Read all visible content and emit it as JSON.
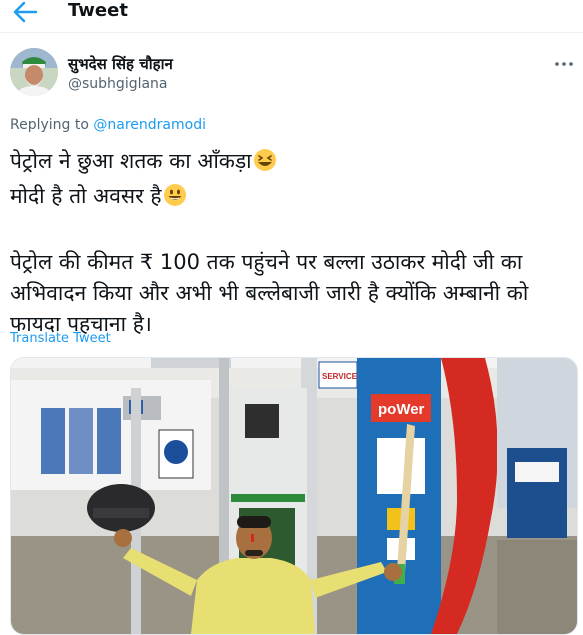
{
  "header": {
    "title": "Tweet"
  },
  "author": {
    "display_name": "सुभदेस सिंह चौहान",
    "handle": "@subhgiglana"
  },
  "reply": {
    "prefix": "Replying to",
    "mention": "@narendramodi"
  },
  "tweet": {
    "line1": "पेट्रोल ने छुआ शतक का आँकड़ा",
    "line2": "मोदी है तो अवसर है",
    "paragraph": "पेट्रोल की कीमत ₹ 100 तक पहुंचने पर बल्ला उठाकर मोदी जी का अभिवादन किया और अभी भी बल्लेबाजी जारी है क्योंकि अम्बानी को फायदा पहचाना है।"
  },
  "translate_label": "Translate Tweet",
  "image_signs": {
    "brand": "poWer",
    "service": "SERVICE"
  },
  "colors": {
    "accent": "#1d9bf0",
    "text": "#0f1419",
    "secondary": "#536471"
  },
  "icons": {
    "back": "arrow-left-icon",
    "more": "more-horizontal-icon",
    "emoji1": "laughing-face-emoji",
    "emoji2": "smiling-face-emoji"
  }
}
